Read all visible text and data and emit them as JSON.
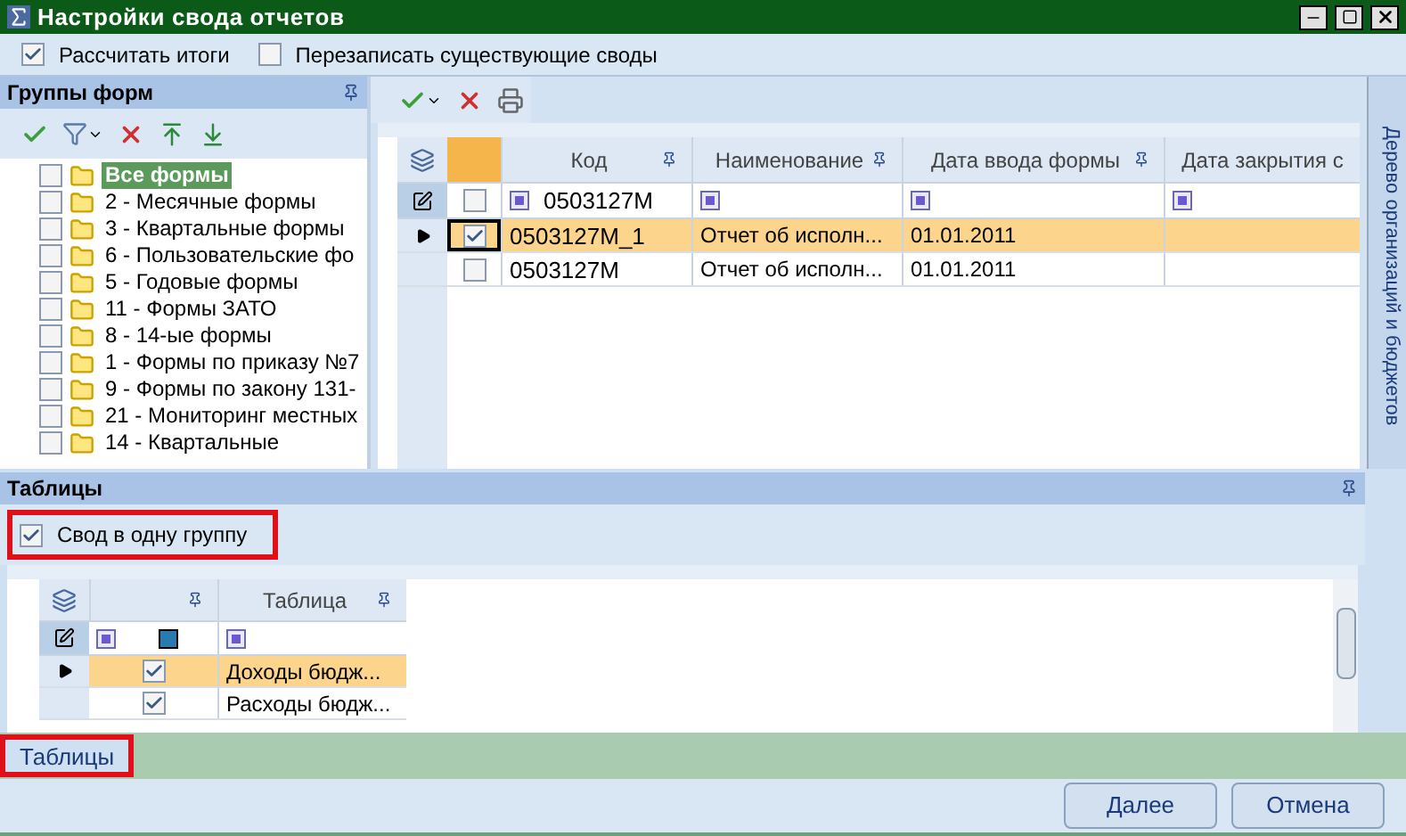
{
  "window": {
    "title": "Настройки свода отчетов"
  },
  "options": [
    {
      "label": "Рассчитать итоги",
      "checked": true
    },
    {
      "label": "Перезаписать существующие своды",
      "checked": false
    }
  ],
  "form_groups": {
    "title": "Группы форм",
    "items": [
      {
        "label": "Все формы",
        "checked": false,
        "selected": true
      },
      {
        "label": "2 - Месячные формы",
        "checked": false,
        "selected": false
      },
      {
        "label": "3 - Квартальные формы",
        "checked": false,
        "selected": false
      },
      {
        "label": "6 - Пользовательские фо",
        "checked": false,
        "selected": false
      },
      {
        "label": "5 - Годовые формы",
        "checked": false,
        "selected": false
      },
      {
        "label": "11 - Формы ЗАТО",
        "checked": false,
        "selected": false
      },
      {
        "label": "8 - 14-ые формы",
        "checked": false,
        "selected": false
      },
      {
        "label": "1 - Формы по приказу №7",
        "checked": false,
        "selected": false
      },
      {
        "label": "9 - Формы по закону 131-",
        "checked": false,
        "selected": false
      },
      {
        "label": "21 - Мониторинг местных",
        "checked": false,
        "selected": false
      },
      {
        "label": "14 - Квартальные",
        "checked": false,
        "selected": false
      }
    ]
  },
  "forms_grid": {
    "columns": [
      "Код",
      "Наименование",
      "Дата ввода формы",
      "Дата закрытия с"
    ],
    "filter": {
      "checked": false,
      "code": "0503127М"
    },
    "rows": [
      {
        "checked": true,
        "selected": true,
        "code": "0503127М_1",
        "name": "Отчет об исполн...",
        "date": "01.01.2011"
      },
      {
        "checked": false,
        "selected": false,
        "code": "0503127М",
        "name": "Отчет об исполн...",
        "date": "01.01.2011"
      }
    ]
  },
  "side_tab": {
    "label": "Дерево организаций и бюджетов"
  },
  "tables": {
    "title": "Таблицы",
    "group_option": {
      "label": "Свод в одну группу",
      "checked": true
    },
    "columns": [
      "Таблица"
    ],
    "rows": [
      {
        "checked": true,
        "selected": true,
        "label": "Доходы бюдж..."
      },
      {
        "checked": true,
        "selected": false,
        "label": "Расходы бюдж..."
      }
    ]
  },
  "bottom_tab": {
    "label": "Таблицы",
    "selected": true
  },
  "buttons": [
    "Далее",
    "Отмена"
  ]
}
